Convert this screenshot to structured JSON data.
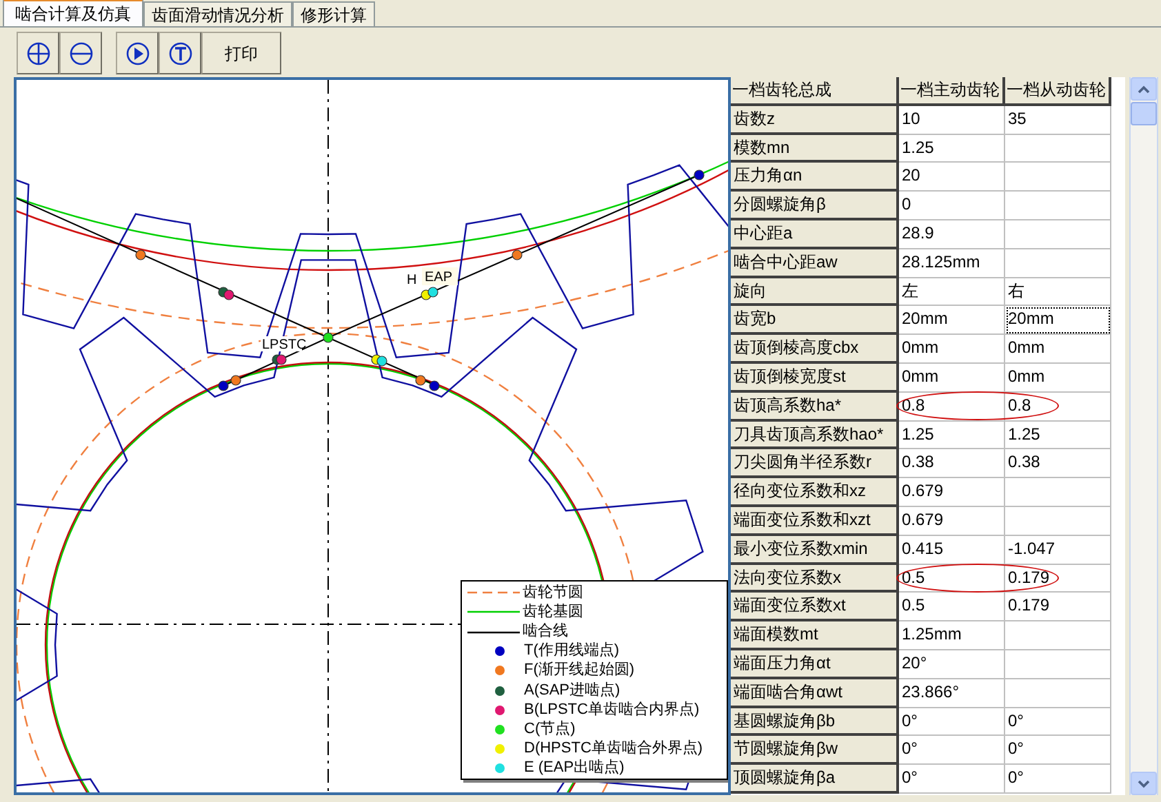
{
  "tabs": [
    {
      "label": "啮合计算及仿真",
      "selected": true
    },
    {
      "label": "齿面滑动情况分析",
      "selected": false
    },
    {
      "label": "修形计算",
      "selected": false
    }
  ],
  "toolbar": {
    "print_button": "打印"
  },
  "drawing": {
    "labels": [
      "H",
      "EAP",
      "LPSTC"
    ],
    "legend": [
      {
        "kind": "line",
        "label": "齿轮节圆",
        "color": "#f08040",
        "dashed": true
      },
      {
        "kind": "line",
        "label": "齿轮基圆",
        "color": "#00d000",
        "dashed": false
      },
      {
        "kind": "line",
        "label": "啮合线",
        "color": "#000000",
        "dashed": false
      },
      {
        "kind": "dot",
        "label": "T(作用线端点)",
        "color": "#0000c0"
      },
      {
        "kind": "dot",
        "label": "F(渐开线起始圆)",
        "color": "#f07820"
      },
      {
        "kind": "dot",
        "label": "A(SAP进啮点)",
        "color": "#206040"
      },
      {
        "kind": "dot",
        "label": "B(LPSTC单齿啮合内界点)",
        "color": "#e01870"
      },
      {
        "kind": "dot",
        "label": "C(节点)",
        "color": "#20e020"
      },
      {
        "kind": "dot",
        "label": "D(HPSTC单齿啮合外界点)",
        "color": "#f0f000"
      },
      {
        "kind": "dot",
        "label": "E (EAP出啮点)",
        "color": "#20e0e0"
      }
    ]
  },
  "table": {
    "columns": [
      "一档齿轮总成",
      "一档主动齿轮",
      "一档从动齿轮"
    ],
    "rows": [
      {
        "label": "齿数z",
        "driving": "10",
        "driven": "35",
        "circled": false,
        "focused": false
      },
      {
        "label": "模数mn",
        "driving": "1.25",
        "circled": false,
        "focused": false
      },
      {
        "label": "压力角αn",
        "driving": "20",
        "circled": false,
        "focused": false
      },
      {
        "label": "分圆螺旋角β",
        "driving": "0",
        "circled": false,
        "focused": false
      },
      {
        "label": "中心距a",
        "driving": "28.9",
        "circled": false,
        "focused": false
      },
      {
        "label": "啮合中心距aw",
        "driving": "28.125mm",
        "circled": false,
        "focused": false
      },
      {
        "label": "旋向",
        "driving": "左",
        "driven": "右",
        "circled": false,
        "focused": false
      },
      {
        "label": "齿宽b",
        "driving": "20mm",
        "driven": "20mm",
        "circled": false,
        "focused": true
      },
      {
        "label": "齿顶倒棱高度cbx",
        "driving": "0mm",
        "driven": "0mm",
        "circled": false,
        "focused": false
      },
      {
        "label": "齿顶倒棱宽度st",
        "driving": "0mm",
        "driven": "0mm",
        "circled": false,
        "focused": false
      },
      {
        "label": "齿顶高系数ha*",
        "driving": "0.8",
        "driven": "0.8",
        "circled": true,
        "focused": false
      },
      {
        "label": "刀具齿顶高系数hao*",
        "driving": "1.25",
        "driven": "1.25",
        "circled": false,
        "focused": false
      },
      {
        "label": "刀尖圆角半径系数r",
        "driving": "0.38",
        "driven": "0.38",
        "circled": false,
        "focused": false
      },
      {
        "label": "径向变位系数和xz",
        "driving": "0.679",
        "circled": false,
        "focused": false
      },
      {
        "label": "端面变位系数和xzt",
        "driving": "0.679",
        "circled": false,
        "focused": false
      },
      {
        "label": "最小变位系数xmin",
        "driving": "0.415",
        "driven": "-1.047",
        "circled": false,
        "focused": false
      },
      {
        "label": "法向变位系数x",
        "driving": "0.5",
        "driven": "0.179",
        "circled": true,
        "focused": false
      },
      {
        "label": "端面变位系数xt",
        "driving": "0.5",
        "driven": "0.179",
        "circled": false,
        "focused": false
      },
      {
        "label": "端面模数mt",
        "driving": "1.25mm",
        "circled": false,
        "focused": false
      },
      {
        "label": "端面压力角αt",
        "driving": "20°",
        "circled": false,
        "focused": false
      },
      {
        "label": "端面啮合角αwt",
        "driving": "23.866°",
        "circled": false,
        "focused": false
      },
      {
        "label": "基圆螺旋角βb",
        "driving": "0°",
        "driven": "0°",
        "circled": false,
        "focused": false
      },
      {
        "label": "节圆螺旋角βw",
        "driving": "0°",
        "driven": "0°",
        "circled": false,
        "focused": false
      },
      {
        "label": "顶圆螺旋角βa",
        "driving": "0°",
        "driven": "0°",
        "circled": false,
        "focused": false
      }
    ]
  }
}
